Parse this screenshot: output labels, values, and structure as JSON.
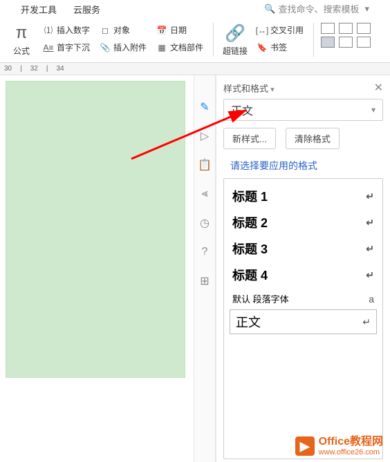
{
  "tabs": {
    "dev": "开发工具",
    "cloud": "云服务"
  },
  "search": {
    "placeholder": "查找命令、搜索模板"
  },
  "ribbon": {
    "formula": "公式",
    "insert_num": "插入数字",
    "object": "对象",
    "date": "日期",
    "dropcap": "首字下沉",
    "attach": "插入附件",
    "docparts": "文档部件",
    "hyperlink": "超链接",
    "xref": "交叉引用",
    "bookmark": "书签"
  },
  "ruler": {
    "n30": "30",
    "n32": "32",
    "n34": "34"
  },
  "panel": {
    "title": "样式和格式",
    "current": "正文",
    "new_style": "新样式...",
    "clear": "清除格式",
    "hint": "请选择要应用的格式",
    "styles": [
      {
        "name": "标题 1"
      },
      {
        "name": "标题 2"
      },
      {
        "name": "标题 3"
      },
      {
        "name": "标题 4"
      },
      {
        "name": "默认 段落字体"
      },
      {
        "name": "正文"
      }
    ]
  },
  "watermark": {
    "line1": "Office教程网",
    "line2": "www.office26.com"
  }
}
